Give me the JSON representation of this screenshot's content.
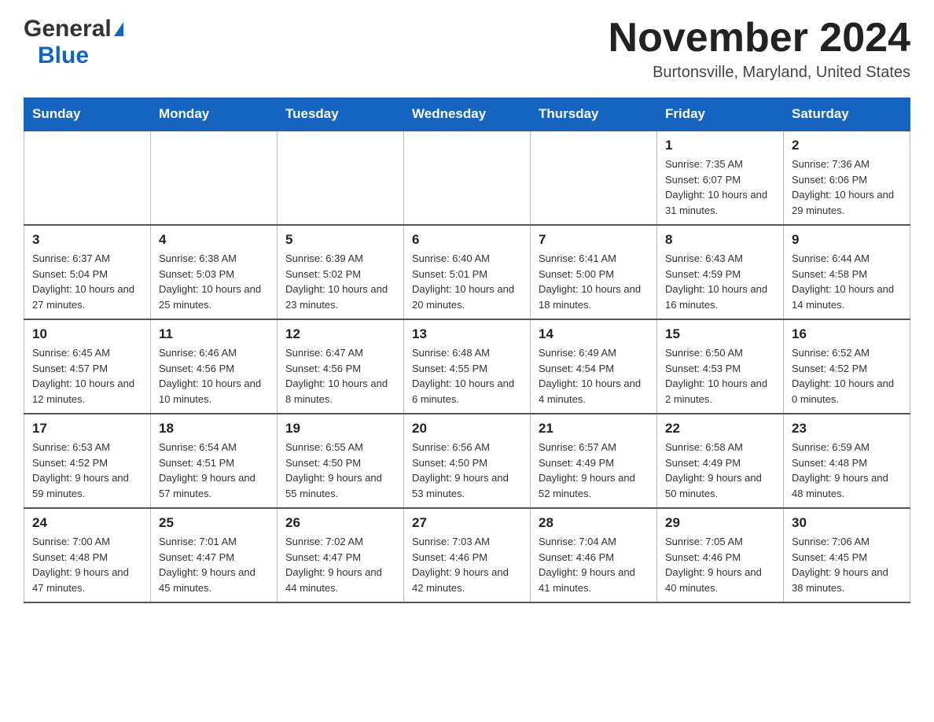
{
  "header": {
    "logo_general": "General",
    "logo_blue": "Blue",
    "month_title": "November 2024",
    "location": "Burtonsville, Maryland, United States"
  },
  "days_of_week": [
    "Sunday",
    "Monday",
    "Tuesday",
    "Wednesday",
    "Thursday",
    "Friday",
    "Saturday"
  ],
  "weeks": [
    [
      {
        "day": "",
        "sunrise": "",
        "sunset": "",
        "daylight": ""
      },
      {
        "day": "",
        "sunrise": "",
        "sunset": "",
        "daylight": ""
      },
      {
        "day": "",
        "sunrise": "",
        "sunset": "",
        "daylight": ""
      },
      {
        "day": "",
        "sunrise": "",
        "sunset": "",
        "daylight": ""
      },
      {
        "day": "",
        "sunrise": "",
        "sunset": "",
        "daylight": ""
      },
      {
        "day": "1",
        "sunrise": "Sunrise: 7:35 AM",
        "sunset": "Sunset: 6:07 PM",
        "daylight": "Daylight: 10 hours and 31 minutes."
      },
      {
        "day": "2",
        "sunrise": "Sunrise: 7:36 AM",
        "sunset": "Sunset: 6:06 PM",
        "daylight": "Daylight: 10 hours and 29 minutes."
      }
    ],
    [
      {
        "day": "3",
        "sunrise": "Sunrise: 6:37 AM",
        "sunset": "Sunset: 5:04 PM",
        "daylight": "Daylight: 10 hours and 27 minutes."
      },
      {
        "day": "4",
        "sunrise": "Sunrise: 6:38 AM",
        "sunset": "Sunset: 5:03 PM",
        "daylight": "Daylight: 10 hours and 25 minutes."
      },
      {
        "day": "5",
        "sunrise": "Sunrise: 6:39 AM",
        "sunset": "Sunset: 5:02 PM",
        "daylight": "Daylight: 10 hours and 23 minutes."
      },
      {
        "day": "6",
        "sunrise": "Sunrise: 6:40 AM",
        "sunset": "Sunset: 5:01 PM",
        "daylight": "Daylight: 10 hours and 20 minutes."
      },
      {
        "day": "7",
        "sunrise": "Sunrise: 6:41 AM",
        "sunset": "Sunset: 5:00 PM",
        "daylight": "Daylight: 10 hours and 18 minutes."
      },
      {
        "day": "8",
        "sunrise": "Sunrise: 6:43 AM",
        "sunset": "Sunset: 4:59 PM",
        "daylight": "Daylight: 10 hours and 16 minutes."
      },
      {
        "day": "9",
        "sunrise": "Sunrise: 6:44 AM",
        "sunset": "Sunset: 4:58 PM",
        "daylight": "Daylight: 10 hours and 14 minutes."
      }
    ],
    [
      {
        "day": "10",
        "sunrise": "Sunrise: 6:45 AM",
        "sunset": "Sunset: 4:57 PM",
        "daylight": "Daylight: 10 hours and 12 minutes."
      },
      {
        "day": "11",
        "sunrise": "Sunrise: 6:46 AM",
        "sunset": "Sunset: 4:56 PM",
        "daylight": "Daylight: 10 hours and 10 minutes."
      },
      {
        "day": "12",
        "sunrise": "Sunrise: 6:47 AM",
        "sunset": "Sunset: 4:56 PM",
        "daylight": "Daylight: 10 hours and 8 minutes."
      },
      {
        "day": "13",
        "sunrise": "Sunrise: 6:48 AM",
        "sunset": "Sunset: 4:55 PM",
        "daylight": "Daylight: 10 hours and 6 minutes."
      },
      {
        "day": "14",
        "sunrise": "Sunrise: 6:49 AM",
        "sunset": "Sunset: 4:54 PM",
        "daylight": "Daylight: 10 hours and 4 minutes."
      },
      {
        "day": "15",
        "sunrise": "Sunrise: 6:50 AM",
        "sunset": "Sunset: 4:53 PM",
        "daylight": "Daylight: 10 hours and 2 minutes."
      },
      {
        "day": "16",
        "sunrise": "Sunrise: 6:52 AM",
        "sunset": "Sunset: 4:52 PM",
        "daylight": "Daylight: 10 hours and 0 minutes."
      }
    ],
    [
      {
        "day": "17",
        "sunrise": "Sunrise: 6:53 AM",
        "sunset": "Sunset: 4:52 PM",
        "daylight": "Daylight: 9 hours and 59 minutes."
      },
      {
        "day": "18",
        "sunrise": "Sunrise: 6:54 AM",
        "sunset": "Sunset: 4:51 PM",
        "daylight": "Daylight: 9 hours and 57 minutes."
      },
      {
        "day": "19",
        "sunrise": "Sunrise: 6:55 AM",
        "sunset": "Sunset: 4:50 PM",
        "daylight": "Daylight: 9 hours and 55 minutes."
      },
      {
        "day": "20",
        "sunrise": "Sunrise: 6:56 AM",
        "sunset": "Sunset: 4:50 PM",
        "daylight": "Daylight: 9 hours and 53 minutes."
      },
      {
        "day": "21",
        "sunrise": "Sunrise: 6:57 AM",
        "sunset": "Sunset: 4:49 PM",
        "daylight": "Daylight: 9 hours and 52 minutes."
      },
      {
        "day": "22",
        "sunrise": "Sunrise: 6:58 AM",
        "sunset": "Sunset: 4:49 PM",
        "daylight": "Daylight: 9 hours and 50 minutes."
      },
      {
        "day": "23",
        "sunrise": "Sunrise: 6:59 AM",
        "sunset": "Sunset: 4:48 PM",
        "daylight": "Daylight: 9 hours and 48 minutes."
      }
    ],
    [
      {
        "day": "24",
        "sunrise": "Sunrise: 7:00 AM",
        "sunset": "Sunset: 4:48 PM",
        "daylight": "Daylight: 9 hours and 47 minutes."
      },
      {
        "day": "25",
        "sunrise": "Sunrise: 7:01 AM",
        "sunset": "Sunset: 4:47 PM",
        "daylight": "Daylight: 9 hours and 45 minutes."
      },
      {
        "day": "26",
        "sunrise": "Sunrise: 7:02 AM",
        "sunset": "Sunset: 4:47 PM",
        "daylight": "Daylight: 9 hours and 44 minutes."
      },
      {
        "day": "27",
        "sunrise": "Sunrise: 7:03 AM",
        "sunset": "Sunset: 4:46 PM",
        "daylight": "Daylight: 9 hours and 42 minutes."
      },
      {
        "day": "28",
        "sunrise": "Sunrise: 7:04 AM",
        "sunset": "Sunset: 4:46 PM",
        "daylight": "Daylight: 9 hours and 41 minutes."
      },
      {
        "day": "29",
        "sunrise": "Sunrise: 7:05 AM",
        "sunset": "Sunset: 4:46 PM",
        "daylight": "Daylight: 9 hours and 40 minutes."
      },
      {
        "day": "30",
        "sunrise": "Sunrise: 7:06 AM",
        "sunset": "Sunset: 4:45 PM",
        "daylight": "Daylight: 9 hours and 38 minutes."
      }
    ]
  ]
}
